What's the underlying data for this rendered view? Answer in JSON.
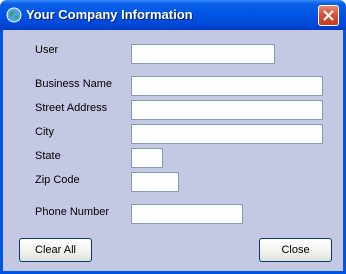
{
  "window": {
    "title": "Your Company Information",
    "icon": "globe-icon",
    "close_icon": "close-icon",
    "title_bar_color": "#0054e3",
    "client_background": "#c5c8e2"
  },
  "form": {
    "user_label": "User",
    "user_value": "",
    "business_name_label": "Business Name",
    "business_name_value": "",
    "street_address_label": "Street Address",
    "street_address_value": "",
    "city_label": "City",
    "city_value": "",
    "state_label": "State",
    "state_value": "",
    "zip_code_label": "Zip Code",
    "zip_code_value": "",
    "phone_number_label": "Phone Number",
    "phone_number_value": ""
  },
  "buttons": {
    "clear_all_label": "Clear All",
    "close_label": "Close"
  }
}
